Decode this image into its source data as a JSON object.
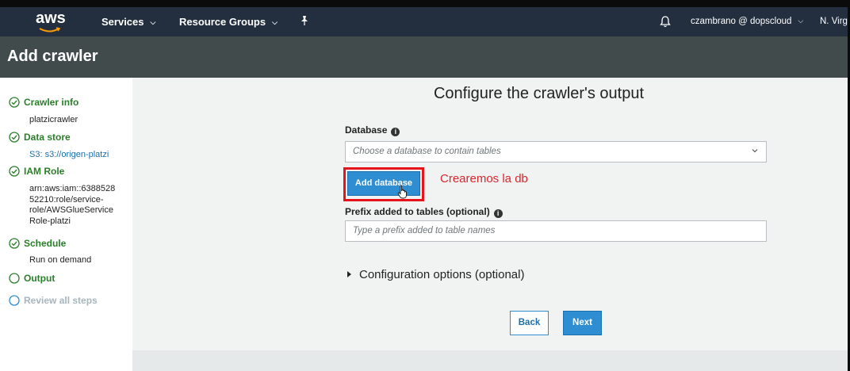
{
  "topnav": {
    "logo_text": "aws",
    "services_label": "Services",
    "resource_groups_label": "Resource Groups",
    "account_label": "czambrano @ dopscloud",
    "region_label": "N. Virg"
  },
  "page": {
    "title": "Add crawler"
  },
  "sidebar": {
    "steps": [
      {
        "label": "Crawler info",
        "detail": "platzicrawler",
        "status": "complete"
      },
      {
        "label": "Data store",
        "detail": "S3: s3://origen-platzi",
        "status": "complete"
      },
      {
        "label": "IAM Role",
        "detail_lines": [
          "arn:aws:iam::6388528",
          "52210:role/service-",
          "role/AWSGlueService",
          "Role-platzi"
        ],
        "status": "complete"
      },
      {
        "label": "Schedule",
        "detail": "Run on demand",
        "status": "complete"
      },
      {
        "label": "Output",
        "status": "current"
      },
      {
        "label": "Review all steps",
        "status": "pending"
      }
    ]
  },
  "main": {
    "title": "Configure the crawler's output",
    "database_label": "Database",
    "database_placeholder": "Choose a database to contain tables",
    "add_database_label": "Add database",
    "annotation_text": "Crearemos la db",
    "prefix_label": "Prefix added to tables (optional)",
    "prefix_placeholder": "Type a prefix added to table names",
    "config_options_label": "Configuration options (optional)",
    "back_label": "Back",
    "next_label": "Next"
  },
  "colors": {
    "nav_bg": "#232f3e",
    "header_bg": "#424b4c",
    "primary_blue": "#2f8ed2",
    "success_green": "#2a7f2a",
    "annotation_red": "#e8141b"
  },
  "icons": [
    "aws-smile-icon",
    "chevron-down-icon",
    "pin-icon",
    "bell-icon",
    "check-circle-icon",
    "circle-icon",
    "info-icon",
    "hand-cursor-icon",
    "triangle-right-icon"
  ]
}
